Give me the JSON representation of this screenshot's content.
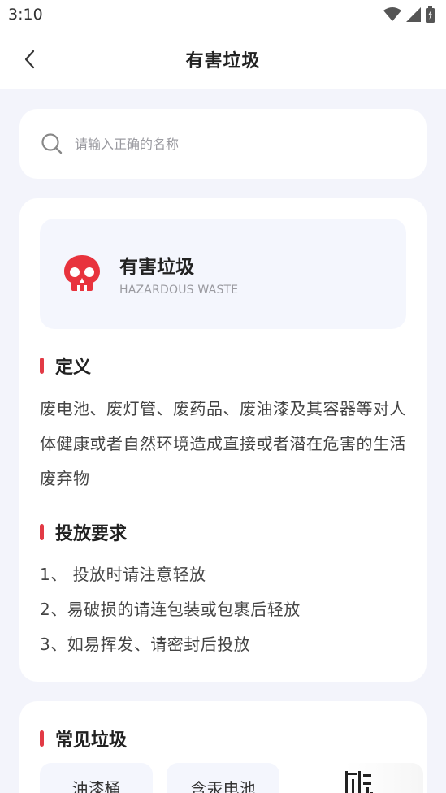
{
  "status_bar": {
    "time": "3:10"
  },
  "app_bar": {
    "title": "有害垃圾"
  },
  "search": {
    "placeholder": "请输入正确的名称"
  },
  "category": {
    "name": "有害垃圾",
    "name_en": "HAZARDOUS WASTE",
    "icon": "skull-icon",
    "icon_color": "#e8333d"
  },
  "accent_color": "#e23a45",
  "definition": {
    "heading": "定义",
    "text": "废电池、废灯管、废药品、废油漆及其容器等对人体健康或者自然环境造成直接或者潜在危害的生活废弃物"
  },
  "requirements": {
    "heading": "投放要求",
    "items": [
      "1、 投放时请注意轻放",
      "2、易破损的请连包装或包裹后轻放",
      "3、如易挥发、请密封后投放"
    ]
  },
  "common": {
    "heading": "常见垃圾",
    "items": [
      {
        "label": "油漆桶"
      },
      {
        "label": "含汞电池"
      },
      {
        "label": ""
      }
    ]
  }
}
